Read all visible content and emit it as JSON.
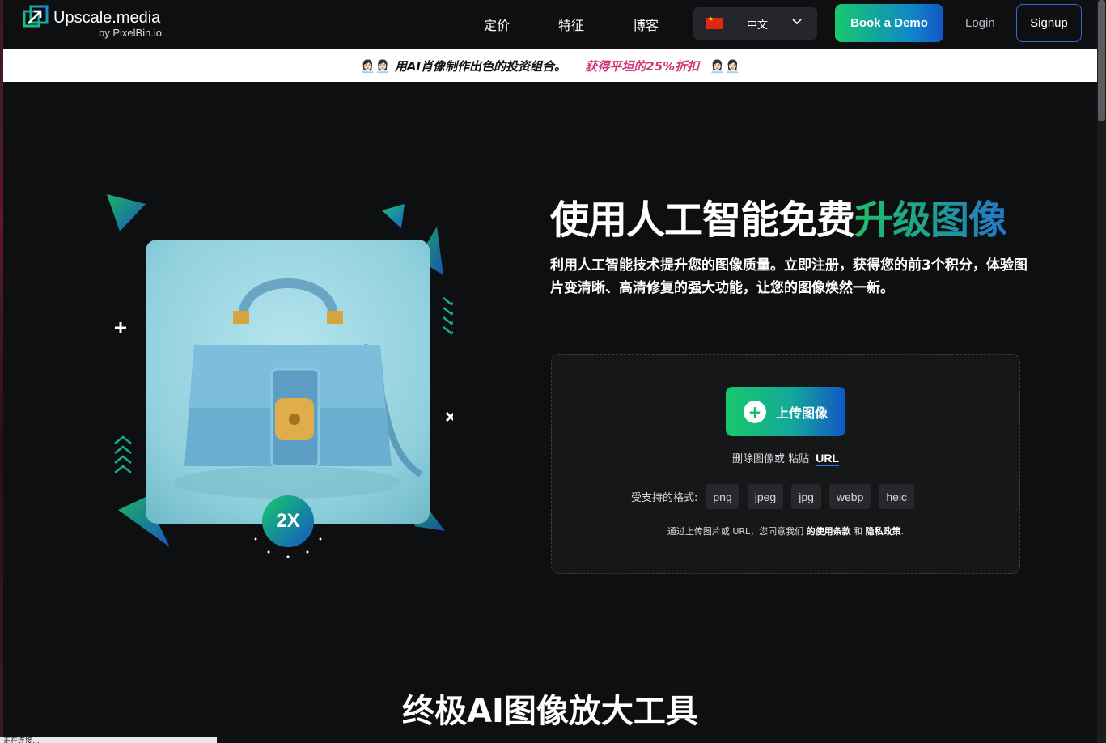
{
  "brand": {
    "name": "Upscale.media",
    "byline": "by PixelBin.io",
    "colors": {
      "green": "#18c96a",
      "blue": "#1356c5",
      "pink": "#d03a7a",
      "background": "#0e0f11"
    }
  },
  "nav": {
    "pricing": "定价",
    "features": "特征",
    "blog": "博客",
    "language": {
      "flag_icon": "china-flag-icon",
      "label": "中文"
    },
    "demo": "Book a Demo",
    "login": "Login",
    "signup": "Signup"
  },
  "banner": {
    "emoji": "👩🏻‍💼👩🏻‍💼",
    "text": "用AI肖像制作出色的投资组合。",
    "link": "获得平坦的25%折扣"
  },
  "hero": {
    "title_main": "使用人工智能免费",
    "title_accent": "升级图像",
    "subtitle": "利用人工智能技术提升您的图像质量。立即注册，获得您的前3个积分，体验图片变清晰、高清修复的强大功能，让您的图像焕然一新。",
    "badge": "2X"
  },
  "upload": {
    "button": "上传图像",
    "drop_text": "删除图像或 粘贴",
    "url_link": "URL",
    "formats_label": "受支持的格式:",
    "formats": [
      "png",
      "jpeg",
      "jpg",
      "webp",
      "heic"
    ],
    "terms_prefix": "通过上传图片或 URL，您同意我们 ",
    "terms_link": "的使用条款",
    "terms_and": " 和 ",
    "privacy_link": "隐私政策",
    "terms_suffix": "."
  },
  "section": {
    "title": "终极AI图像放大工具"
  },
  "status_bar": {
    "text": "正在连接..."
  }
}
